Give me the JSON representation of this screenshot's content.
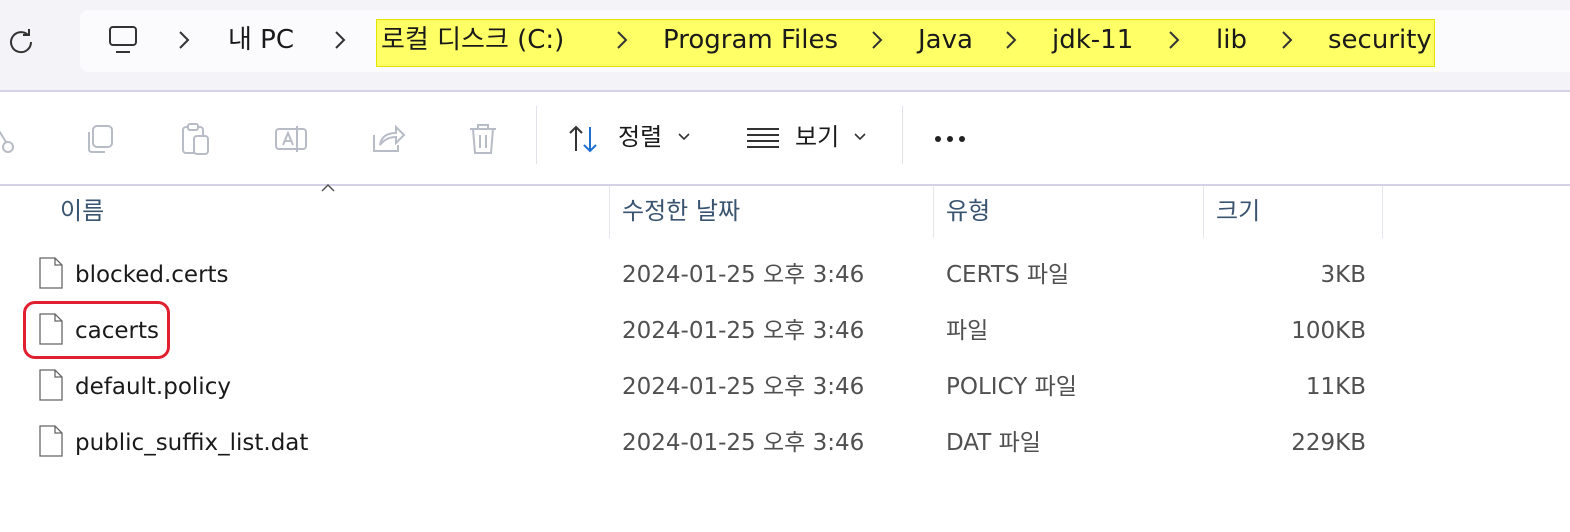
{
  "breadcrumb": {
    "items": [
      "내 PC",
      "로컬 디스크 (C:)",
      "Program Files",
      "Java",
      "jdk-11",
      "lib",
      "security"
    ]
  },
  "toolbar": {
    "sort_label": "정렬",
    "view_label": "보기",
    "icons": [
      "cut-icon",
      "copy-icon",
      "paste-icon",
      "rename-icon",
      "share-icon",
      "delete-icon",
      "sort-icon",
      "view-icon",
      "more-icon"
    ]
  },
  "list": {
    "columns": [
      "이름",
      "수정한 날짜",
      "유형",
      "크기"
    ],
    "rows": [
      {
        "name": "blocked.certs",
        "modified": "2024-01-25 오후 3:46",
        "type": "CERTS 파일",
        "size": "3KB"
      },
      {
        "name": "cacerts",
        "modified": "2024-01-25 오후 3:46",
        "type": "파일",
        "size": "100KB"
      },
      {
        "name": "default.policy",
        "modified": "2024-01-25 오후 3:46",
        "type": "POLICY 파일",
        "size": "11KB"
      },
      {
        "name": "public_suffix_list.dat",
        "modified": "2024-01-25 오후 3:46",
        "type": "DAT 파일",
        "size": "229KB"
      }
    ]
  },
  "colors": {
    "highlight": "#ffff66",
    "annotation": "#e02030",
    "sort_icon_blue": "#1e6fd0"
  }
}
